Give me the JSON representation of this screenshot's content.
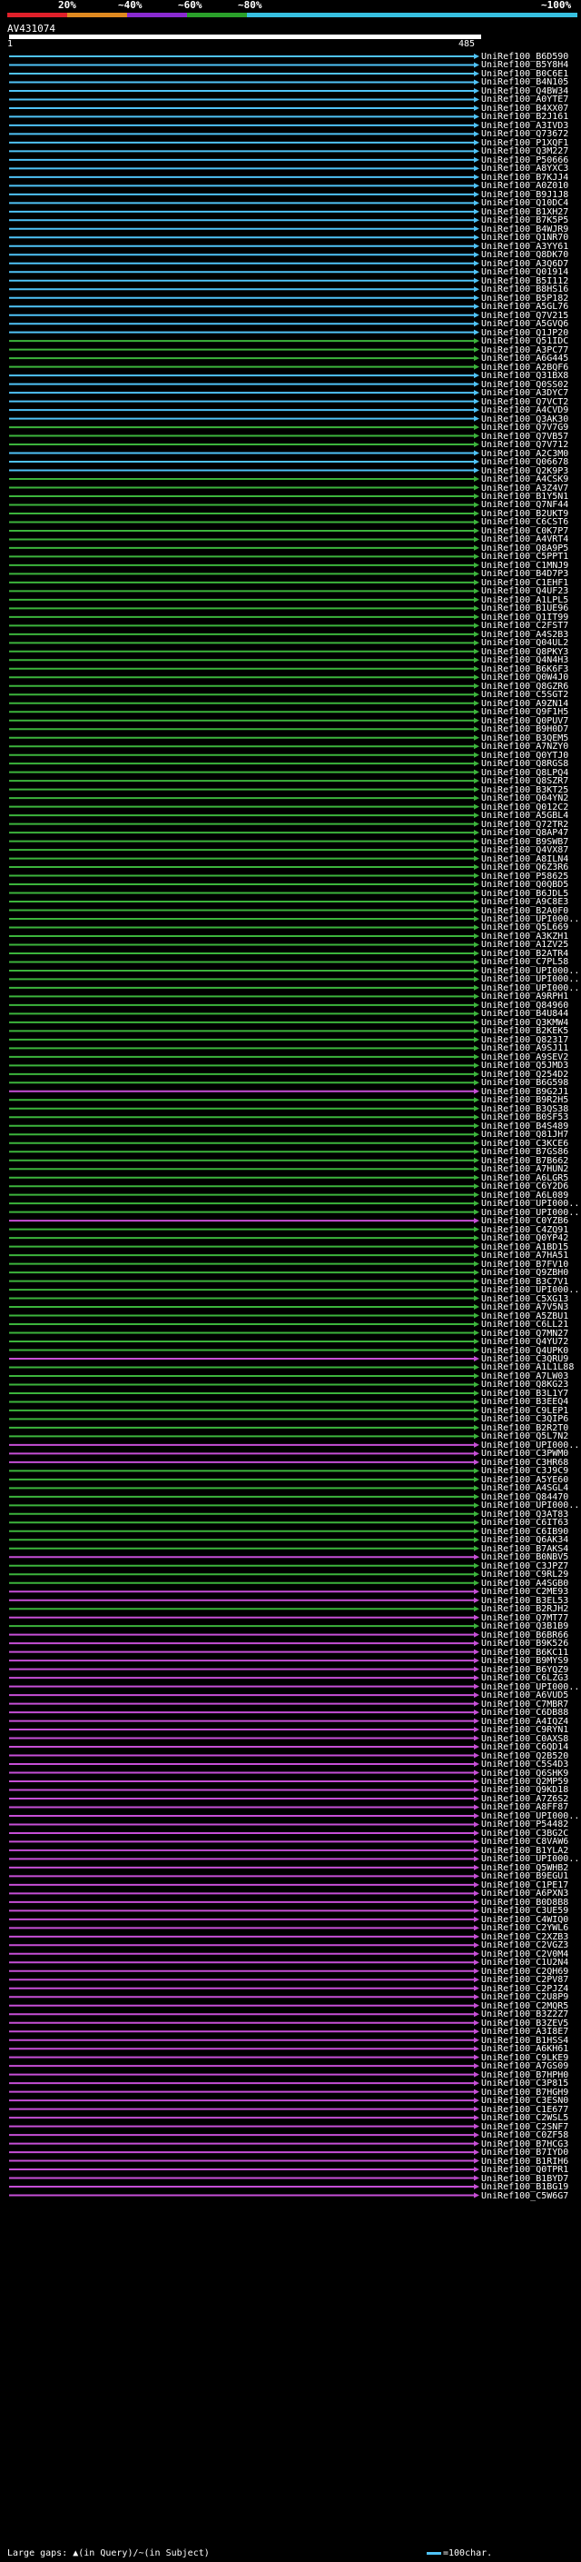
{
  "query_id": "AV431074",
  "ruler": {
    "start": "1",
    "end": "485"
  },
  "scale_labels": [
    "20%",
    "~40%",
    "~60%",
    "~80%",
    "~100%"
  ],
  "colors": {
    "scale_red": "#e0202a",
    "scale_orange": "#e08a20",
    "scale_purple": "#8a2ad0",
    "scale_green": "#2aa02a",
    "scale_cyan": "#37c0e0",
    "hit_cyan": "#4fc3f7",
    "hit_green": "#3cb43c",
    "hit_magenta": "#c64fd6"
  },
  "legend": {
    "left": "Large gaps: ▲(in Query)/~(in Subject)",
    "right": "=100char."
  },
  "hits": [
    {
      "label": "UniRef100_B6D590",
      "color": "cyan"
    },
    {
      "label": "UniRef100_B5Y8H4",
      "color": "cyan"
    },
    {
      "label": "UniRef100_B0C6E1",
      "color": "cyan"
    },
    {
      "label": "UniRef100_B4N105",
      "color": "cyan"
    },
    {
      "label": "UniRef100_Q4BW34",
      "color": "cyan"
    },
    {
      "label": "UniRef100_A0YTE7",
      "color": "cyan"
    },
    {
      "label": "UniRef100_B4XX07",
      "color": "cyan"
    },
    {
      "label": "UniRef100_B2J161",
      "color": "cyan"
    },
    {
      "label": "UniRef100_A3IVD3",
      "color": "cyan"
    },
    {
      "label": "UniRef100_Q73672",
      "color": "cyan"
    },
    {
      "label": "UniRef100_P1XQF1",
      "color": "cyan"
    },
    {
      "label": "UniRef100_Q3M227",
      "color": "cyan"
    },
    {
      "label": "UniRef100_P50666",
      "color": "cyan"
    },
    {
      "label": "UniRef100_A8YXC3",
      "color": "cyan"
    },
    {
      "label": "UniRef100_B7KJJ4",
      "color": "cyan"
    },
    {
      "label": "UniRef100_A0Z010",
      "color": "cyan"
    },
    {
      "label": "UniRef100_B9J1J8",
      "color": "cyan"
    },
    {
      "label": "UniRef100_Q10DC4",
      "color": "cyan"
    },
    {
      "label": "UniRef100_B1XH27",
      "color": "cyan"
    },
    {
      "label": "UniRef100_B7K5P5",
      "color": "cyan"
    },
    {
      "label": "UniRef100_B4WJR9",
      "color": "cyan"
    },
    {
      "label": "UniRef100_Q1NR70",
      "color": "cyan"
    },
    {
      "label": "UniRef100_A3YY61",
      "color": "cyan"
    },
    {
      "label": "UniRef100_Q8DK70",
      "color": "cyan"
    },
    {
      "label": "UniRef100_A3Q6D7",
      "color": "cyan"
    },
    {
      "label": "UniRef100_Q01914",
      "color": "cyan"
    },
    {
      "label": "UniRef100_B5I112",
      "color": "cyan"
    },
    {
      "label": "UniRef100_B8HS16",
      "color": "cyan"
    },
    {
      "label": "UniRef100_B5P182",
      "color": "cyan"
    },
    {
      "label": "UniRef100_A5GL76",
      "color": "cyan"
    },
    {
      "label": "UniRef100_Q7V215",
      "color": "cyan"
    },
    {
      "label": "UniRef100_A5GVQ6",
      "color": "cyan"
    },
    {
      "label": "UniRef100_Q1JP20",
      "color": "cyan"
    },
    {
      "label": "UniRef100_Q51IDC",
      "color": "green"
    },
    {
      "label": "UniRef100_A3PC77",
      "color": "green"
    },
    {
      "label": "UniRef100_A6G445",
      "color": "green"
    },
    {
      "label": "UniRef100_A2BQF6",
      "color": "green"
    },
    {
      "label": "UniRef100_Q31BX8",
      "color": "cyan"
    },
    {
      "label": "UniRef100_Q0SS02",
      "color": "cyan"
    },
    {
      "label": "UniRef100_A3DYC7",
      "color": "cyan"
    },
    {
      "label": "UniRef100_Q7VCT2",
      "color": "cyan"
    },
    {
      "label": "UniRef100_A4CVD9",
      "color": "cyan"
    },
    {
      "label": "UniRef100_Q3AK30",
      "color": "cyan"
    },
    {
      "label": "UniRef100_Q7V7G9",
      "color": "green"
    },
    {
      "label": "UniRef100_Q7VB57",
      "color": "green"
    },
    {
      "label": "UniRef100_Q7V712",
      "color": "green"
    },
    {
      "label": "UniRef100_A2C3M0",
      "color": "cyan"
    },
    {
      "label": "UniRef100_Q06678",
      "color": "cyan"
    },
    {
      "label": "UniRef100_Q2K9P3",
      "color": "cyan"
    },
    {
      "label": "UniRef100_A4CSK9",
      "color": "green"
    },
    {
      "label": "UniRef100_A3Z4V7",
      "color": "green"
    },
    {
      "label": "UniRef100_B1Y5N1",
      "color": "green"
    },
    {
      "label": "UniRef100_Q7NF44",
      "color": "green"
    },
    {
      "label": "UniRef100_B2UKT9",
      "color": "green"
    },
    {
      "label": "UniRef100_C6CST6",
      "color": "green"
    },
    {
      "label": "UniRef100_C0K7P7",
      "color": "green"
    },
    {
      "label": "UniRef100_A4VRT4",
      "color": "green"
    },
    {
      "label": "UniRef100_Q8A9P5",
      "color": "green"
    },
    {
      "label": "UniRef100_C5PPT1",
      "color": "green"
    },
    {
      "label": "UniRef100_C1MNJ9",
      "color": "green"
    },
    {
      "label": "UniRef100_B4D7P3",
      "color": "green"
    },
    {
      "label": "UniRef100_C1EHF1",
      "color": "green"
    },
    {
      "label": "UniRef100_Q4UF23",
      "color": "green"
    },
    {
      "label": "UniRef100_A1LPL5",
      "color": "green"
    },
    {
      "label": "UniRef100_B1UE96",
      "color": "green"
    },
    {
      "label": "UniRef100_Q1IT99",
      "color": "green"
    },
    {
      "label": "UniRef100_C2FST7",
      "color": "green"
    },
    {
      "label": "UniRef100_A4S2B3",
      "color": "green"
    },
    {
      "label": "UniRef100_Q04UL2",
      "color": "green"
    },
    {
      "label": "UniRef100_Q8PKY3",
      "color": "green"
    },
    {
      "label": "UniRef100_Q4N4H3",
      "color": "green"
    },
    {
      "label": "UniRef100_B6K6F3",
      "color": "green"
    },
    {
      "label": "UniRef100_Q0W4J0",
      "color": "green"
    },
    {
      "label": "UniRef100_Q8GZR6",
      "color": "green"
    },
    {
      "label": "UniRef100_C5SGT2",
      "color": "green"
    },
    {
      "label": "UniRef100_A9ZN14",
      "color": "green"
    },
    {
      "label": "UniRef100_Q9F1H5",
      "color": "green"
    },
    {
      "label": "UniRef100_Q0PUV7",
      "color": "green"
    },
    {
      "label": "UniRef100_B9H0D7",
      "color": "green"
    },
    {
      "label": "UniRef100_B3QEM5",
      "color": "green"
    },
    {
      "label": "UniRef100_A7NZY0",
      "color": "green"
    },
    {
      "label": "UniRef100_Q0YTJ0",
      "color": "green"
    },
    {
      "label": "UniRef100_Q8RGS8",
      "color": "green"
    },
    {
      "label": "UniRef100_Q8LPQ4",
      "color": "green"
    },
    {
      "label": "UniRef100_Q8SZR7",
      "color": "green"
    },
    {
      "label": "UniRef100_B3KT25",
      "color": "green"
    },
    {
      "label": "UniRef100_Q04YN2",
      "color": "green"
    },
    {
      "label": "UniRef100_Q012C2",
      "color": "green"
    },
    {
      "label": "UniRef100_A5GBL4",
      "color": "green"
    },
    {
      "label": "UniRef100_Q72TR2",
      "color": "green"
    },
    {
      "label": "UniRef100_Q8AP47",
      "color": "green"
    },
    {
      "label": "UniRef100_B9SWB7",
      "color": "green"
    },
    {
      "label": "UniRef100_Q4VX87",
      "color": "green"
    },
    {
      "label": "UniRef100_A8ILN4",
      "color": "green"
    },
    {
      "label": "UniRef100_Q6Z3R6",
      "color": "green"
    },
    {
      "label": "UniRef100_P58625",
      "color": "green"
    },
    {
      "label": "UniRef100_Q0QBD5",
      "color": "green"
    },
    {
      "label": "UniRef100_B6JDL5",
      "color": "green"
    },
    {
      "label": "UniRef100_A9C8E3",
      "color": "green"
    },
    {
      "label": "UniRef100_B2A0F0",
      "color": "green"
    },
    {
      "label": "UniRef100_UPI000...",
      "color": "green"
    },
    {
      "label": "UniRef100_Q5L669",
      "color": "green"
    },
    {
      "label": "UniRef100_A3KZH1",
      "color": "green"
    },
    {
      "label": "UniRef100_A1ZV25",
      "color": "green"
    },
    {
      "label": "UniRef100_B2ATR4",
      "color": "green"
    },
    {
      "label": "UniRef100_C7PL58",
      "color": "green"
    },
    {
      "label": "UniRef100_UPI000...",
      "color": "green"
    },
    {
      "label": "UniRef100_UPI000...",
      "color": "green"
    },
    {
      "label": "UniRef100_UPI000...",
      "color": "green"
    },
    {
      "label": "UniRef100_A9RPH1",
      "color": "green"
    },
    {
      "label": "UniRef100_Q84960",
      "color": "green"
    },
    {
      "label": "UniRef100_B4U844",
      "color": "green"
    },
    {
      "label": "UniRef100_Q3KMW4",
      "color": "green"
    },
    {
      "label": "UniRef100_B2KEK5",
      "color": "green"
    },
    {
      "label": "UniRef100_Q82317",
      "color": "green"
    },
    {
      "label": "UniRef100_A9SJ11",
      "color": "green"
    },
    {
      "label": "UniRef100_A9SEV2",
      "color": "green"
    },
    {
      "label": "UniRef100_Q5JMD3",
      "color": "green"
    },
    {
      "label": "UniRef100_Q254D2",
      "color": "green"
    },
    {
      "label": "UniRef100_B6G598",
      "color": "green"
    },
    {
      "label": "UniRef100_B9G2J1",
      "color": "magenta"
    },
    {
      "label": "UniRef100_B9R2H5",
      "color": "green"
    },
    {
      "label": "UniRef100_B3QS38",
      "color": "green"
    },
    {
      "label": "UniRef100_B0SF53",
      "color": "green"
    },
    {
      "label": "UniRef100_B4S489",
      "color": "green"
    },
    {
      "label": "UniRef100_Q81JH7",
      "color": "green"
    },
    {
      "label": "UniRef100_C3KCE6",
      "color": "green"
    },
    {
      "label": "UniRef100_B7GS86",
      "color": "green"
    },
    {
      "label": "UniRef100_B7B662",
      "color": "green"
    },
    {
      "label": "UniRef100_A7HUN2",
      "color": "green"
    },
    {
      "label": "UniRef100_A6LGR5",
      "color": "green"
    },
    {
      "label": "UniRef100_C6Y2D6",
      "color": "green"
    },
    {
      "label": "UniRef100_A6L089",
      "color": "green"
    },
    {
      "label": "UniRef100_UPI000...",
      "color": "green"
    },
    {
      "label": "UniRef100_UPI000...",
      "color": "green"
    },
    {
      "label": "UniRef100_C0YZB6",
      "color": "magenta"
    },
    {
      "label": "UniRef100_C4ZQ91",
      "color": "green"
    },
    {
      "label": "UniRef100_Q0YP42",
      "color": "green"
    },
    {
      "label": "UniRef100_A1BD15",
      "color": "green"
    },
    {
      "label": "UniRef100_A7HA51",
      "color": "green"
    },
    {
      "label": "UniRef100_B7FV10",
      "color": "green"
    },
    {
      "label": "UniRef100_Q9ZBH0",
      "color": "green"
    },
    {
      "label": "UniRef100_B3C7V1",
      "color": "green"
    },
    {
      "label": "UniRef100_UPI000...",
      "color": "green"
    },
    {
      "label": "UniRef100_C5XG13",
      "color": "green"
    },
    {
      "label": "UniRef100_A7V5N3",
      "color": "green"
    },
    {
      "label": "UniRef100_A5ZBU1",
      "color": "green"
    },
    {
      "label": "UniRef100_C6LL21",
      "color": "green"
    },
    {
      "label": "UniRef100_Q7MN27",
      "color": "green"
    },
    {
      "label": "UniRef100_Q4YU72",
      "color": "green"
    },
    {
      "label": "UniRef100_Q4UPK0",
      "color": "green"
    },
    {
      "label": "UniRef100_C3QRU9",
      "color": "magenta"
    },
    {
      "label": "UniRef100_A1L1L88",
      "color": "green"
    },
    {
      "label": "UniRef100_A7LW03",
      "color": "green"
    },
    {
      "label": "UniRef100_Q8KG23",
      "color": "green"
    },
    {
      "label": "UniRef100_B3L1Y7",
      "color": "green"
    },
    {
      "label": "UniRef100_B3EEQ4",
      "color": "green"
    },
    {
      "label": "UniRef100_C9LEP1",
      "color": "green"
    },
    {
      "label": "UniRef100_C3QIP6",
      "color": "green"
    },
    {
      "label": "UniRef100_B2R2T0",
      "color": "green"
    },
    {
      "label": "UniRef100_Q5L7N2",
      "color": "green"
    },
    {
      "label": "UniRef100_UPI000...",
      "color": "magenta"
    },
    {
      "label": "UniRef100_C3PWM0",
      "color": "magenta"
    },
    {
      "label": "UniRef100_C3HR68",
      "color": "magenta"
    },
    {
      "label": "UniRef100_C3J9C9",
      "color": "green"
    },
    {
      "label": "UniRef100_A5YE60",
      "color": "green"
    },
    {
      "label": "UniRef100_A4SGL4",
      "color": "green"
    },
    {
      "label": "UniRef100_Q84470",
      "color": "green"
    },
    {
      "label": "UniRef100_UPI000...",
      "color": "green"
    },
    {
      "label": "UniRef100_Q3AT83",
      "color": "green"
    },
    {
      "label": "UniRef100_C6IT63",
      "color": "green"
    },
    {
      "label": "UniRef100_C6IB90",
      "color": "green"
    },
    {
      "label": "UniRef100_Q6AK34",
      "color": "green"
    },
    {
      "label": "UniRef100_B7AKS4",
      "color": "green"
    },
    {
      "label": "UniRef100_B0NBV5",
      "color": "magenta"
    },
    {
      "label": "UniRef100_C3JPZ7",
      "color": "green"
    },
    {
      "label": "UniRef100_C9RL29",
      "color": "green"
    },
    {
      "label": "UniRef100_A4SGB0",
      "color": "green"
    },
    {
      "label": "UniRef100_C2ME93",
      "color": "magenta"
    },
    {
      "label": "UniRef100_B3EL53",
      "color": "magenta"
    },
    {
      "label": "UniRef100_B2RJH2",
      "color": "green"
    },
    {
      "label": "UniRef100_Q7MT77",
      "color": "magenta"
    },
    {
      "label": "UniRef100_Q3B1B9",
      "color": "green"
    },
    {
      "label": "UniRef100_B6BR66",
      "color": "magenta"
    },
    {
      "label": "UniRef100_B9K526",
      "color": "magenta"
    },
    {
      "label": "UniRef100_B6KC11",
      "color": "magenta"
    },
    {
      "label": "UniRef100_B9MYS9",
      "color": "magenta"
    },
    {
      "label": "UniRef100_B6YQZ9",
      "color": "magenta"
    },
    {
      "label": "UniRef100_C6LZG3",
      "color": "magenta"
    },
    {
      "label": "UniRef100_UPI000...",
      "color": "magenta"
    },
    {
      "label": "UniRef100_A6VUD5",
      "color": "magenta"
    },
    {
      "label": "UniRef100_C7MBR7",
      "color": "magenta"
    },
    {
      "label": "UniRef100_C6DB88",
      "color": "magenta"
    },
    {
      "label": "UniRef100_A4IQZ4",
      "color": "magenta"
    },
    {
      "label": "UniRef100_C9RYN1",
      "color": "magenta"
    },
    {
      "label": "UniRef100_C0AXS8",
      "color": "magenta"
    },
    {
      "label": "UniRef100_C6QD14",
      "color": "magenta"
    },
    {
      "label": "UniRef100_Q2B520",
      "color": "magenta"
    },
    {
      "label": "UniRef100_C5S4D3",
      "color": "magenta"
    },
    {
      "label": "UniRef100_Q6SHK9",
      "color": "magenta"
    },
    {
      "label": "UniRef100_Q2MP59",
      "color": "magenta"
    },
    {
      "label": "UniRef100_Q9KD18",
      "color": "magenta"
    },
    {
      "label": "UniRef100_A7Z6S2",
      "color": "magenta"
    },
    {
      "label": "UniRef100_A8FF87",
      "color": "magenta"
    },
    {
      "label": "UniRef100_UPI000...",
      "color": "magenta"
    },
    {
      "label": "UniRef100_P54482",
      "color": "magenta"
    },
    {
      "label": "UniRef100_C3BG2C",
      "color": "magenta"
    },
    {
      "label": "UniRef100_C8VAW6",
      "color": "magenta"
    },
    {
      "label": "UniRef100_B1YLA2",
      "color": "magenta"
    },
    {
      "label": "UniRef100_UPI000...",
      "color": "magenta"
    },
    {
      "label": "UniRef100_Q5WHB2",
      "color": "magenta"
    },
    {
      "label": "UniRef100_B9EGU1",
      "color": "magenta"
    },
    {
      "label": "UniRef100_C1PE17",
      "color": "magenta"
    },
    {
      "label": "UniRef100_A6PXN3",
      "color": "magenta"
    },
    {
      "label": "UniRef100_B0D8B8",
      "color": "magenta"
    },
    {
      "label": "UniRef100_C3UE59",
      "color": "magenta"
    },
    {
      "label": "UniRef100_C4WIQ0",
      "color": "magenta"
    },
    {
      "label": "UniRef100_C2YWL6",
      "color": "magenta"
    },
    {
      "label": "UniRef100_C2XZB3",
      "color": "magenta"
    },
    {
      "label": "UniRef100_C2VGZ3",
      "color": "magenta"
    },
    {
      "label": "UniRef100_C2V0M4",
      "color": "magenta"
    },
    {
      "label": "UniRef100_C1U2N4",
      "color": "magenta"
    },
    {
      "label": "UniRef100_C2QH69",
      "color": "magenta"
    },
    {
      "label": "UniRef100_C2PV87",
      "color": "magenta"
    },
    {
      "label": "UniRef100_C2PJZ4",
      "color": "magenta"
    },
    {
      "label": "UniRef100_C2U8P9",
      "color": "magenta"
    },
    {
      "label": "UniRef100_C2MQR5",
      "color": "magenta"
    },
    {
      "label": "UniRef100_B3Z2Z7",
      "color": "magenta"
    },
    {
      "label": "UniRef100_B3ZEV5",
      "color": "magenta"
    },
    {
      "label": "UniRef100_A3I8E7",
      "color": "magenta"
    },
    {
      "label": "UniRef100_B1HSS4",
      "color": "magenta"
    },
    {
      "label": "UniRef100_A6KH61",
      "color": "magenta"
    },
    {
      "label": "UniRef100_C9LKE9",
      "color": "magenta"
    },
    {
      "label": "UniRef100_A7GS09",
      "color": "magenta"
    },
    {
      "label": "UniRef100_B7HPH0",
      "color": "magenta"
    },
    {
      "label": "UniRef100_C3P815",
      "color": "magenta"
    },
    {
      "label": "UniRef100_B7HGH9",
      "color": "magenta"
    },
    {
      "label": "UniRef100_C3ESN0",
      "color": "magenta"
    },
    {
      "label": "UniRef100_C1E677",
      "color": "magenta"
    },
    {
      "label": "UniRef100_C2WSL5",
      "color": "magenta"
    },
    {
      "label": "UniRef100_C2SNF7",
      "color": "magenta"
    },
    {
      "label": "UniRef100_C0ZF58",
      "color": "magenta"
    },
    {
      "label": "UniRef100_B7HCG3",
      "color": "magenta"
    },
    {
      "label": "UniRef100_B7IYD0",
      "color": "magenta"
    },
    {
      "label": "UniRef100_B1RIH6",
      "color": "magenta"
    },
    {
      "label": "UniRef100_Q0TPR1",
      "color": "magenta"
    },
    {
      "label": "UniRef100_B1BYD7",
      "color": "magenta"
    },
    {
      "label": "UniRef100_B1BG19",
      "color": "magenta"
    },
    {
      "label": "UniRef100_C5W6G7",
      "color": "magenta"
    }
  ]
}
